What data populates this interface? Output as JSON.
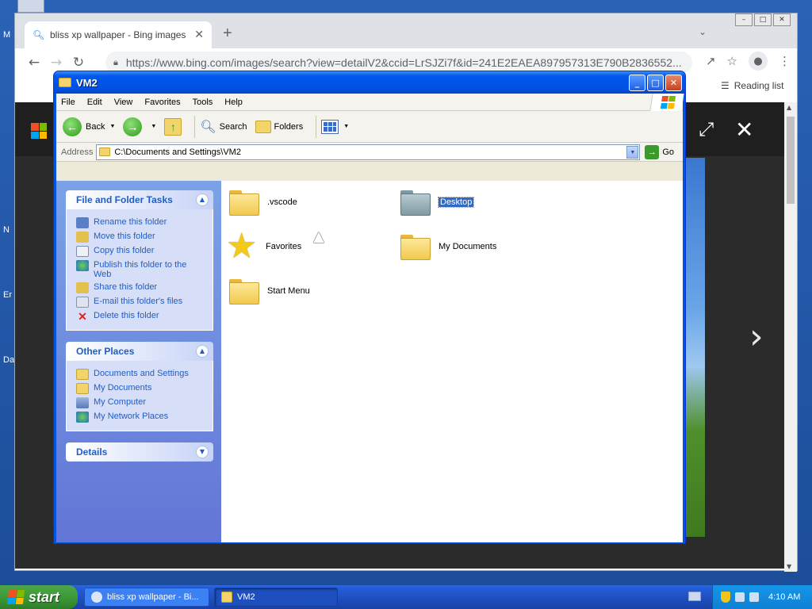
{
  "desktop": {
    "labels": [
      "M",
      "N",
      "Er",
      "Da"
    ]
  },
  "browser": {
    "tab_title": "bliss xp wallpaper - Bing images",
    "tab_close": "✕",
    "new_tab": "+",
    "url": "https://www.bing.com/images/search?view=detailV2&ccid=LrSJZi7f&id=241E2EAEA897957313E790B2836552...",
    "reading_list": "Reading list"
  },
  "explorer": {
    "title": "VM2",
    "menu": [
      "File",
      "Edit",
      "View",
      "Favorites",
      "Tools",
      "Help"
    ],
    "toolbar": {
      "back": "Back",
      "search": "Search",
      "folders": "Folders"
    },
    "address": {
      "label": "Address",
      "value": "C:\\Documents and Settings\\VM2",
      "go": "Go"
    },
    "file_folder_tasks": {
      "title": "File and Folder Tasks",
      "items": [
        "Rename this folder",
        "Move this folder",
        "Copy this folder",
        "Publish this folder to the Web",
        "Share this folder",
        "E-mail this folder's files",
        "Delete this folder"
      ]
    },
    "other_places": {
      "title": "Other Places",
      "items": [
        "Documents and Settings",
        "My Documents",
        "My Computer",
        "My Network Places"
      ]
    },
    "details": {
      "title": "Details"
    },
    "files": [
      {
        "name": ".vscode",
        "icon": "folder-icon"
      },
      {
        "name": "Desktop",
        "icon": "desktop-folder-icon",
        "selected": true
      },
      {
        "name": "Favorites",
        "icon": "star-icon"
      },
      {
        "name": "My Documents",
        "icon": "folder-icon"
      },
      {
        "name": "Start Menu",
        "icon": "folder-icon"
      }
    ]
  },
  "taskbar": {
    "start": "start",
    "tasks": [
      {
        "label": "bliss xp wallpaper - Bi...",
        "active": false
      },
      {
        "label": "VM2",
        "active": true
      }
    ],
    "clock": "4:10 AM"
  },
  "colors": {
    "xp_blue": "#0054e3",
    "task_link": "#215dc6",
    "selection": "#316ac5",
    "start_green": "#3c9b37"
  }
}
